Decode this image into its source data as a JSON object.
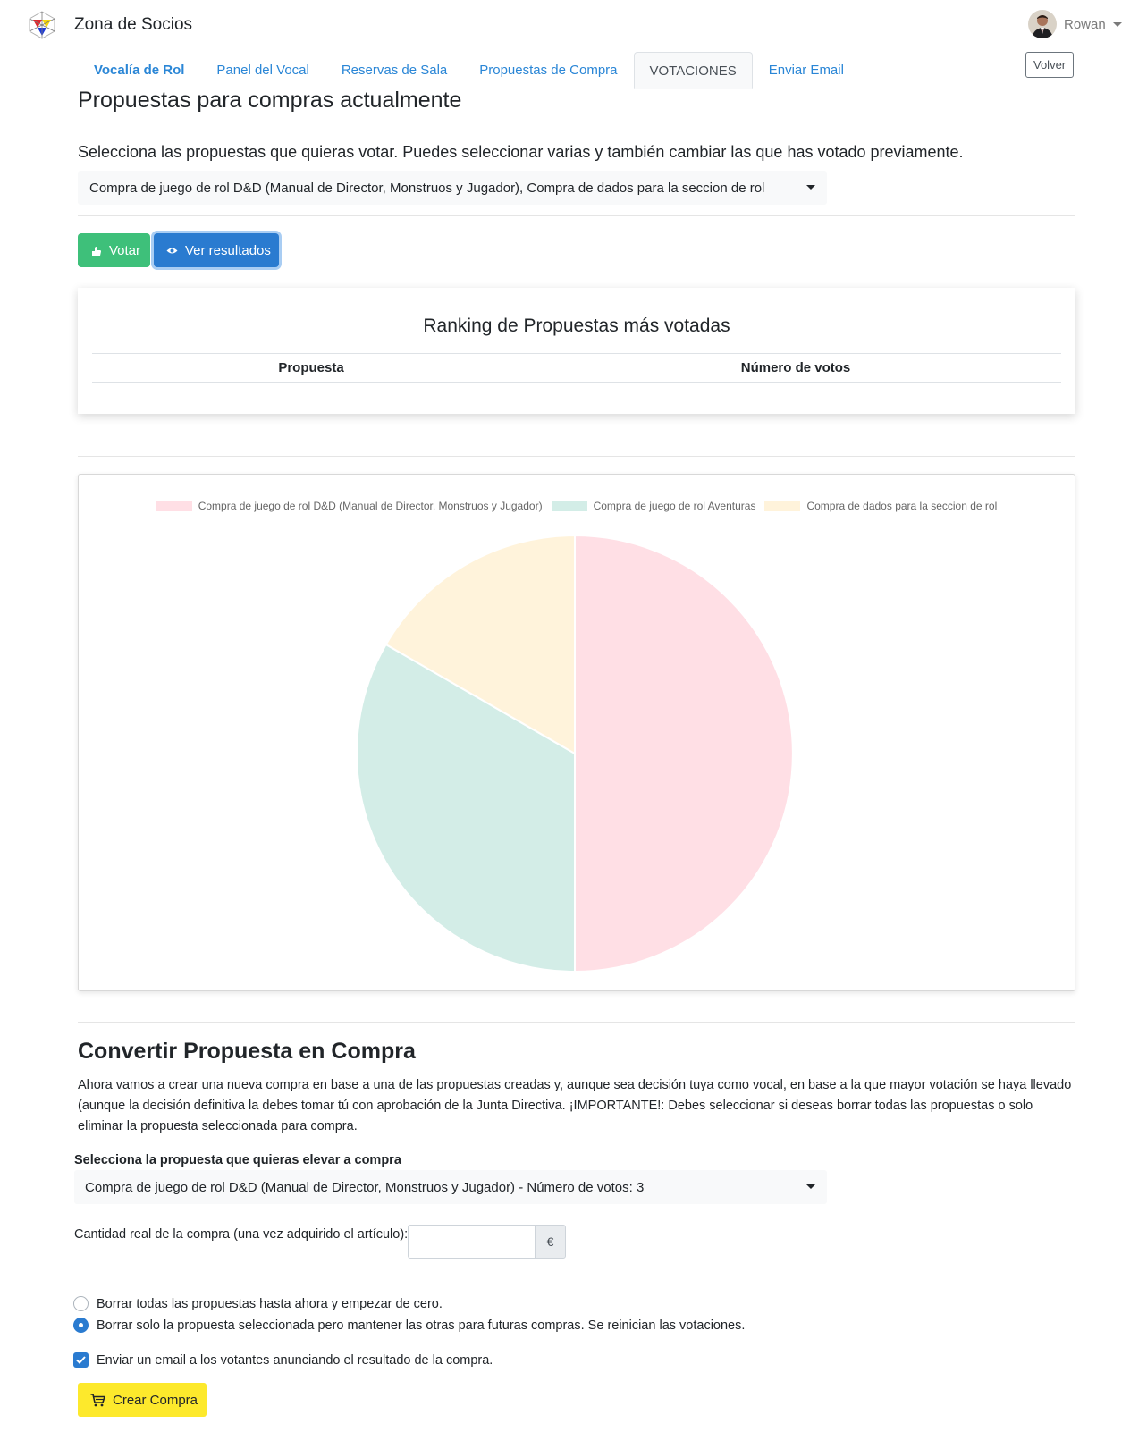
{
  "app": {
    "title": "Zona de Socios"
  },
  "user": {
    "name": "Rowan"
  },
  "tabs": [
    {
      "label": "Vocalía de Rol"
    },
    {
      "label": "Panel del Vocal"
    },
    {
      "label": "Reservas de Sala"
    },
    {
      "label": "Propuestas de Compra"
    },
    {
      "label": "VOTACIONES"
    },
    {
      "label": "Enviar Email"
    }
  ],
  "volver": {
    "label": "Volver"
  },
  "votes": {
    "heading": "Propuestas para compras actualmente",
    "intro": "Selecciona las propuestas que quieras votar. Puedes seleccionar varias y también cambiar las que has votado previamente.",
    "selected": "Compra de juego de rol D&D (Manual de Director, Monstruos y Jugador), Compra de dados para la seccion de rol",
    "vote_button": "Votar",
    "results_button": "Ver resultados"
  },
  "ranking": {
    "title": "Ranking de Propuestas más votadas",
    "col_proposal": "Propuesta",
    "col_votes": "Número de votos"
  },
  "chart_data": {
    "type": "pie",
    "labels": [
      "Compra de juego de rol D&D (Manual de Director, Monstruos y Jugador)",
      "Compra de juego de rol Aventuras",
      "Compra de dados para la seccion de rol"
    ],
    "values": [
      3,
      2,
      1
    ],
    "colors": [
      "#ffdfe5",
      "#d3ede7",
      "#fff3db"
    ],
    "legend_position": "top"
  },
  "convert": {
    "heading": "Convertir Propuesta en Compra",
    "text": "Ahora vamos a crear una nueva compra en base a una de las propuestas creadas y, aunque sea decisión tuya como vocal, en base a la que mayor votación se haya llevado (aunque la decisión definitiva la debes tomar tú con aprobación de la Junta Directiva. ¡IMPORTANTE!: Debes seleccionar si deseas borrar todas las propuestas o solo eliminar la propuesta seleccionada para compra.",
    "select_label": "Selecciona la propuesta que quieras elevar a compra",
    "select_value": "Compra de juego de rol D&D (Manual de Director, Monstruos y Jugador) - Número de votos: 3",
    "qty_label": "Cantidad real de la compra (una vez adquirido el artículo):",
    "qty_value": "",
    "currency": "€",
    "option_all": "Borrar todas las propuestas hasta ahora y empezar de cero.",
    "option_selected": "Borrar solo la propuesta seleccionada pero mantener las otras para futuras compras. Se reinician las votaciones.",
    "email_option": "Enviar un email a los votantes anunciando el resultado de la compra.",
    "create_button": "Crear Compra"
  }
}
